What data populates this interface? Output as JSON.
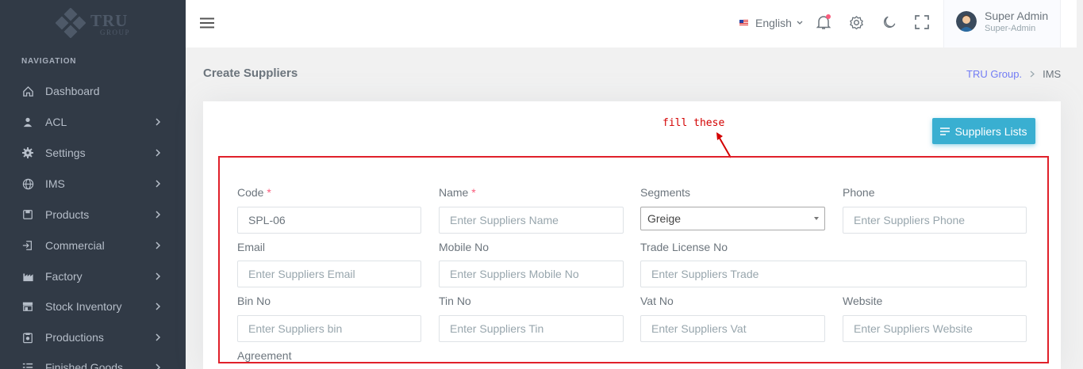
{
  "brand": {
    "name": "TRU",
    "sub": "GROUP"
  },
  "sidebar": {
    "title": "NAVIGATION",
    "items": [
      {
        "label": "Dashboard",
        "icon": "home-icon"
      },
      {
        "label": "ACL",
        "icon": "user-icon"
      },
      {
        "label": "Settings",
        "icon": "gear-icon"
      },
      {
        "label": "IMS",
        "icon": "globe-icon"
      },
      {
        "label": "Products",
        "icon": "save-icon"
      },
      {
        "label": "Commercial",
        "icon": "login-icon"
      },
      {
        "label": "Factory",
        "icon": "factory-icon"
      },
      {
        "label": "Stock Inventory",
        "icon": "store-icon"
      },
      {
        "label": "Productions",
        "icon": "clipboard-icon"
      },
      {
        "label": "Finished Goods",
        "icon": "list-icon"
      }
    ]
  },
  "topbar": {
    "language": "English",
    "user_name": "Super Admin",
    "user_role": "Super-Admin"
  },
  "page": {
    "title": "Create Suppliers",
    "breadcrumb": [
      "TRU Group.",
      "IMS"
    ]
  },
  "annotation": {
    "text": "fill these"
  },
  "form": {
    "list_button": "Suppliers Lists",
    "code": {
      "label": "Code",
      "value": "SPL-06"
    },
    "name": {
      "label": "Name",
      "placeholder": "Enter Suppliers Name"
    },
    "segments": {
      "label": "Segments",
      "value": "Greige"
    },
    "phone": {
      "label": "Phone",
      "placeholder": "Enter Suppliers Phone"
    },
    "email": {
      "label": "Email",
      "placeholder": "Enter Suppliers Email"
    },
    "mobile": {
      "label": "Mobile No",
      "placeholder": "Enter Suppliers Mobile No"
    },
    "trade": {
      "label": "Trade License No",
      "placeholder": "Enter Suppliers Trade"
    },
    "bin": {
      "label": "Bin No",
      "placeholder": "Enter Suppliers bin"
    },
    "tin": {
      "label": "Tin No",
      "placeholder": "Enter Suppliers Tin"
    },
    "vat": {
      "label": "Vat No",
      "placeholder": "Enter Suppliers Vat"
    },
    "website": {
      "label": "Website",
      "placeholder": "Enter Suppliers Website"
    },
    "agreement": {
      "label": "Agreement"
    }
  },
  "colors": {
    "sidebar": "#313a46",
    "accent": "#39afd1",
    "annotation": "#e0202a"
  }
}
